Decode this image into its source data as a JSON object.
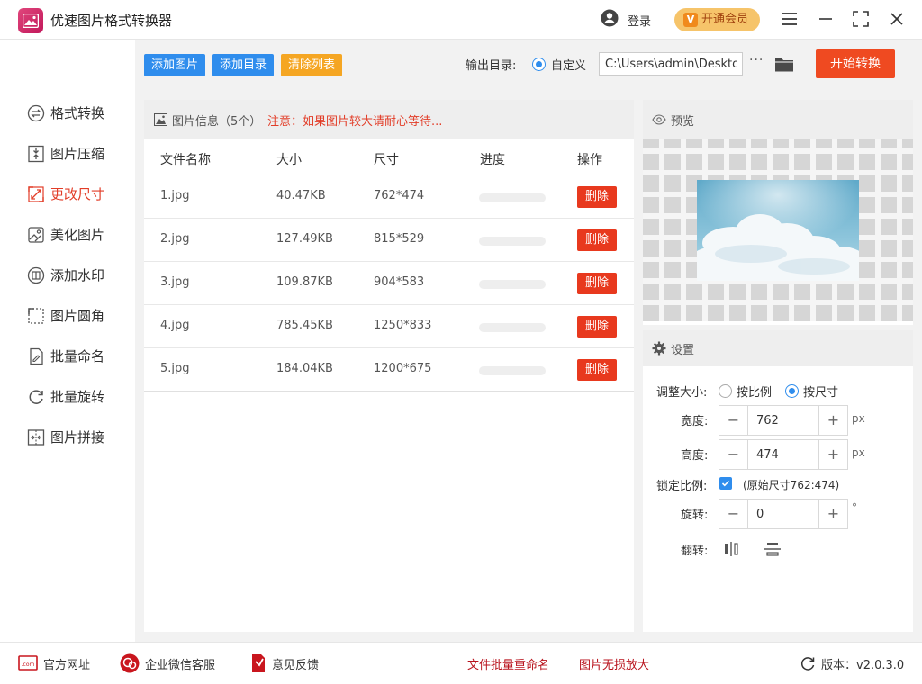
{
  "app": {
    "title": "优速图片格式转换器",
    "login_label": "登录",
    "vip_label": "开通会员",
    "vip_badge": "V"
  },
  "sidebar": {
    "items": [
      {
        "label": "格式转换",
        "icon": "format-convert-icon"
      },
      {
        "label": "图片压缩",
        "icon": "compress-icon"
      },
      {
        "label": "更改尺寸",
        "icon": "resize-icon",
        "active": true
      },
      {
        "label": "美化图片",
        "icon": "beautify-icon"
      },
      {
        "label": "添加水印",
        "icon": "watermark-icon"
      },
      {
        "label": "图片圆角",
        "icon": "rounded-corner-icon"
      },
      {
        "label": "批量命名",
        "icon": "rename-icon"
      },
      {
        "label": "批量旋转",
        "icon": "rotate-icon"
      },
      {
        "label": "图片拼接",
        "icon": "stitch-icon"
      }
    ]
  },
  "toolbar": {
    "add_image": "添加图片",
    "add_folder": "添加目录",
    "clear_list": "清除列表",
    "output_label": "输出目录:",
    "custom_label": "自定义",
    "output_path": "C:\\Users\\admin\\Deskto",
    "more": "···",
    "start": "开始转换"
  },
  "file_list": {
    "header_title": "图片信息（5个）",
    "header_note": "注意：如果图片较大请耐心等待...",
    "columns": [
      "文件名称",
      "大小",
      "尺寸",
      "进度",
      "操作"
    ],
    "delete_label": "删除",
    "rows": [
      {
        "name": "1.jpg",
        "size": "40.47KB",
        "dims": "762*474",
        "progress": 0
      },
      {
        "name": "2.jpg",
        "size": "127.49KB",
        "dims": "815*529",
        "progress": 0
      },
      {
        "name": "3.jpg",
        "size": "109.87KB",
        "dims": "904*583",
        "progress": 0
      },
      {
        "name": "4.jpg",
        "size": "785.45KB",
        "dims": "1250*833",
        "progress": 0
      },
      {
        "name": "5.jpg",
        "size": "184.04KB",
        "dims": "1200*675",
        "progress": 0
      }
    ]
  },
  "preview": {
    "title": "预览"
  },
  "settings": {
    "title": "设置",
    "resize_label": "调整大小:",
    "by_ratio": "按比例",
    "by_size": "按尺寸",
    "selected_mode": "by_size",
    "width_label": "宽度:",
    "width_value": "762",
    "height_label": "高度:",
    "height_value": "474",
    "unit_px": "px",
    "lock_label": "锁定比例:",
    "lock_checked": true,
    "original_size": "(原始尺寸762:474)",
    "rotate_label": "旋转:",
    "rotate_value": "0",
    "rotate_unit": "°",
    "flip_label": "翻转:",
    "minus": "−",
    "plus": "+"
  },
  "footer": {
    "website": "官方网址",
    "wechat": "企业微信客服",
    "feedback": "意见反馈",
    "batch_rename": "文件批量重命名",
    "lossless_enlarge": "图片无损放大",
    "version_label": "版本：",
    "version": "v2.0.3.0",
    "com_badge": ".com"
  },
  "colors": {
    "accent_blue": "#2f8ded",
    "accent_red": "#ef4a21",
    "accent_orange": "#f5a623",
    "active_nav": "#e23d28"
  }
}
